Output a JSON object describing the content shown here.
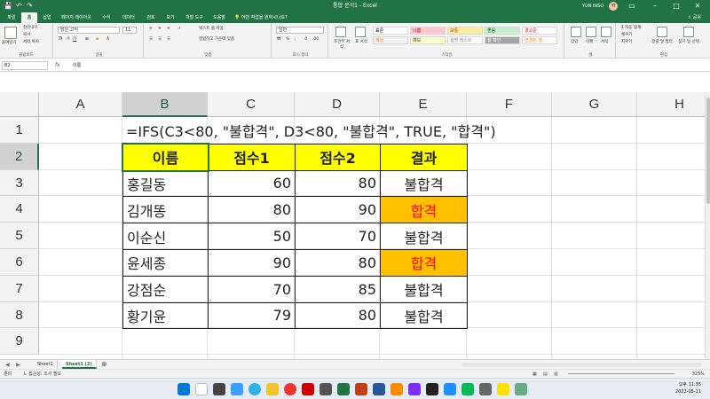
{
  "titlebar": {
    "title": "통합 문서1 - Excel",
    "user": "YUN INSU",
    "avatar_initials": "YI",
    "search_hint": "어떤 작업을 원하시나요?"
  },
  "tabs": [
    "파일",
    "홈",
    "삽입",
    "페이지 레이아웃",
    "수식",
    "데이터",
    "검토",
    "보기",
    "개발 도구",
    "도움말"
  ],
  "share_label": "공유",
  "ribbon": {
    "clipboard": {
      "paste": "붙여넣기",
      "cut": "잘라내기",
      "copy": "복사",
      "format_painter": "서식 복사",
      "label": "클립보드"
    },
    "font": {
      "name": "맑은 고딕",
      "size": "11",
      "label": "글꼴"
    },
    "alignment": {
      "wrap": "텍스트 줄 바꿈",
      "merge": "병합하고 가운데 맞춤",
      "label": "맞춤"
    },
    "number": {
      "format": "일반",
      "label": "표시 형식"
    },
    "styles": {
      "conditional": "조건부 서식",
      "table": "표 서식",
      "cells": [
        {
          "text": "표준",
          "bg": "#ffffff",
          "fg": "#000000"
        },
        {
          "text": "나쁨",
          "bg": "#ffc7ce",
          "fg": "#9c0006"
        },
        {
          "text": "보통",
          "bg": "#ffeb9c",
          "fg": "#9c5700"
        },
        {
          "text": "좋음",
          "bg": "#c6efce",
          "fg": "#006100"
        },
        {
          "text": "경고문",
          "bg": "#ffffff",
          "fg": "#ff0000"
        },
        {
          "text": "계산",
          "bg": "#f2f2f2",
          "fg": "#fa7d00"
        },
        {
          "text": "메모",
          "bg": "#ffffcc",
          "fg": "#333333"
        },
        {
          "text": "설명 텍스트",
          "bg": "#ffffff",
          "fg": "#7f7f7f"
        },
        {
          "text": "셀 확인",
          "bg": "#a5a5a5",
          "fg": "#ffffff"
        },
        {
          "text": "연결된 셀",
          "bg": "#ffffff",
          "fg": "#fa7d00"
        }
      ],
      "label": "스타일"
    },
    "cells": {
      "insert": "삽입",
      "delete": "삭제",
      "format": "서식",
      "label": "셀"
    },
    "editing": {
      "autosum": "자동 합계",
      "fill": "채우기",
      "clear": "지우기",
      "sort": "정렬 및 필터",
      "find": "찾기 및 선택",
      "label": "편집"
    }
  },
  "formula_bar": {
    "name_box": "B2",
    "fx": "fx",
    "content": "이름"
  },
  "columns": [
    "A",
    "B",
    "C",
    "D",
    "E",
    "F",
    "G",
    "H"
  ],
  "rows": [
    "1",
    "2",
    "3",
    "4",
    "5",
    "6",
    "7",
    "8",
    "9"
  ],
  "selected": {
    "column": "B",
    "row": "2"
  },
  "sheet": {
    "formula_text": "=IFS(C3<80, \"불합격\", D3<80, \"불합격\", TRUE, \"합격\")",
    "headers": [
      "이름",
      "점수1",
      "점수2",
      "결과"
    ],
    "records": [
      {
        "name": "홍길동",
        "s1": "60",
        "s2": "80",
        "result": "불합격",
        "pass": false
      },
      {
        "name": "김개똥",
        "s1": "80",
        "s2": "90",
        "result": "합격",
        "pass": true
      },
      {
        "name": "이순신",
        "s1": "50",
        "s2": "70",
        "result": "불합격",
        "pass": false
      },
      {
        "name": "윤세종",
        "s1": "90",
        "s2": "80",
        "result": "합격",
        "pass": true
      },
      {
        "name": "강점순",
        "s1": "70",
        "s2": "85",
        "result": "불합격",
        "pass": false
      },
      {
        "name": "황기윤",
        "s1": "79",
        "s2": "80",
        "result": "불합격",
        "pass": false
      }
    ],
    "header_bg": "#ffff00",
    "pass_bg": "#ffc000",
    "pass_fg": "#ff0000"
  },
  "sheet_tabs": [
    "Sheet1",
    "Sheet1 (2)"
  ],
  "active_sheet": "Sheet1 (2)",
  "status": {
    "mode": "준비",
    "accessibility": "접근성: 조사 필요",
    "zoom": "325%"
  },
  "taskbar": {
    "time": "오후 11:35",
    "date": "2022-05-11"
  }
}
